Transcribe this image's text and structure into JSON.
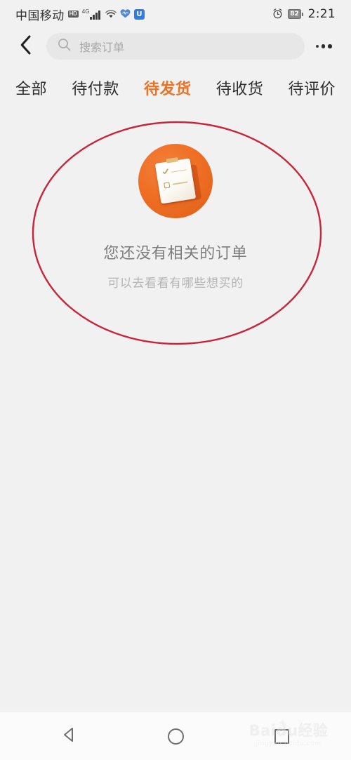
{
  "status_bar": {
    "carrier": "中国移动",
    "hd_badge": "HD",
    "network_type": "4G",
    "signal_icon": "signal-bars-icon",
    "wifi_icon": "wifi-icon",
    "heart_icon": "heart-icon",
    "app_badge": "U",
    "alarm_icon": "alarm-clock-icon",
    "battery_level": "82",
    "time": "2:21"
  },
  "navbar": {
    "back_icon": "back-chevron-icon",
    "search_icon": "search-icon",
    "search_placeholder": "搜索订单",
    "search_value": "",
    "more_icon": "more-options-icon"
  },
  "tabs": [
    {
      "label": "全部",
      "active": false
    },
    {
      "label": "待付款",
      "active": false
    },
    {
      "label": "待发货",
      "active": true
    },
    {
      "label": "待收货",
      "active": false
    },
    {
      "label": "待评价",
      "active": false
    }
  ],
  "empty_state": {
    "illustration": "empty-order-clipboard-icon",
    "title": "您还没有相关的订单",
    "subtitle": "可以去看看有哪些想买的"
  },
  "annotation": {
    "shape": "ellipse",
    "color": "#c8243a"
  },
  "system_nav": {
    "back_icon": "android-back-icon",
    "home_icon": "android-home-icon",
    "recents_icon": "android-recents-icon"
  },
  "watermark": {
    "main": "Baidu经验",
    "sub": "jingyan.baidu.com"
  },
  "colors": {
    "background": "#f1f1f1",
    "accent_orange": "#e8742a",
    "annotation_red": "#c8243a",
    "searchbar": "#e7e7e7"
  }
}
